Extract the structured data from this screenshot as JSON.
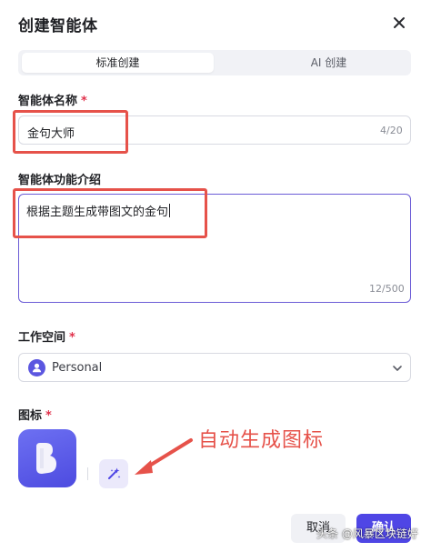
{
  "dialog": {
    "title": "创建智能体"
  },
  "tabs": [
    {
      "label": "标准创建",
      "active": true
    },
    {
      "label": "AI 创建",
      "active": false
    }
  ],
  "fields": {
    "name": {
      "label": "智能体名称",
      "required_mark": "*",
      "value": "金句大师",
      "counter": "4/20"
    },
    "description": {
      "label": "智能体功能介绍",
      "value": "根据主题生成带图文的金句",
      "counter": "12/500"
    },
    "workspace": {
      "label": "工作空间",
      "required_mark": "*",
      "selected": "Personal"
    },
    "icon": {
      "label": "图标",
      "required_mark": "*"
    }
  },
  "annotation": {
    "text": "自动生成图标",
    "color": "#e6524a"
  },
  "footer": {
    "cancel_label": "取消",
    "confirm_label": "确认"
  },
  "watermark": "头条 @风暴区块链好",
  "colors": {
    "accent": "#4f46e5",
    "highlight": "#e6524a",
    "required": "#e0314b"
  },
  "icons": [
    "close-icon",
    "user-icon",
    "chevron-down-icon",
    "app-logo-icon",
    "sparkle-icon"
  ]
}
